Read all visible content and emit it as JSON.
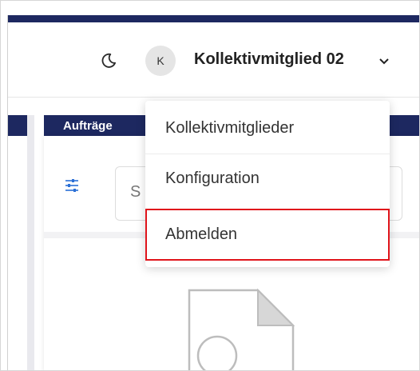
{
  "header": {
    "theme_toggle_icon": "moon-icon",
    "avatar_initial": "K",
    "user_name": "Kollektivmitglied 02",
    "dropdown_icon": "chevron-down-icon"
  },
  "nav": {
    "tab_label": "Aufträge"
  },
  "toolbar": {
    "filter_icon": "sliders-icon",
    "search_placeholder_partial": "S"
  },
  "dropdown_menu": {
    "items": [
      {
        "label": "Kollektivmitglieder"
      },
      {
        "label": "Konfiguration"
      },
      {
        "label": "Abmelden",
        "highlighted": true
      }
    ]
  },
  "empty_state": {
    "icon": "document-icon"
  },
  "colors": {
    "navbar": "#1d2860",
    "accent": "#2a6fd6",
    "highlight_border": "#e0141b"
  }
}
